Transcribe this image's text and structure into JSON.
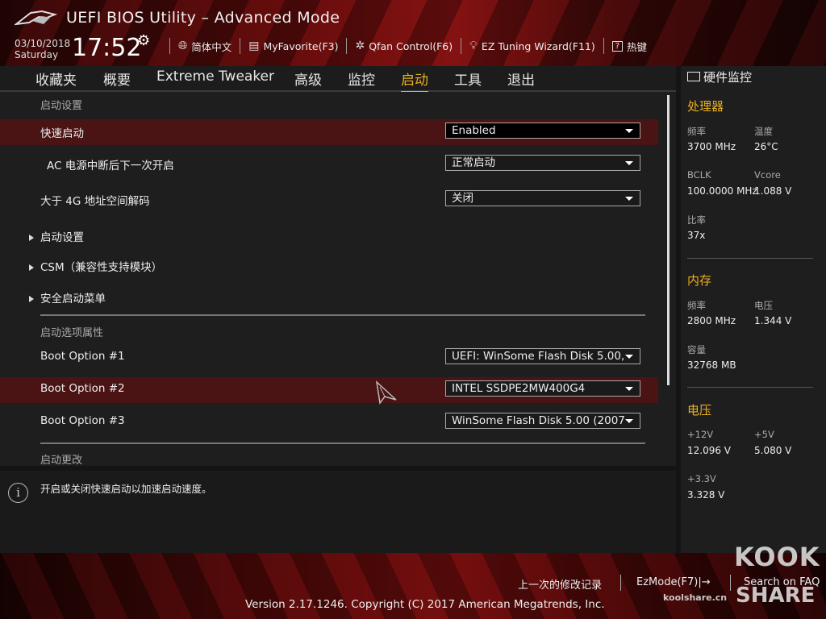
{
  "header": {
    "title": "UEFI BIOS Utility – Advanced Mode",
    "date": "03/10/2018",
    "day": "Saturday",
    "time": "17:52",
    "toolbar": [
      {
        "icon": "globe-icon",
        "label": "简体中文"
      },
      {
        "icon": "favorite-icon",
        "label": "MyFavorite(F3)"
      },
      {
        "icon": "fan-icon",
        "label": "Qfan Control(F6)"
      },
      {
        "icon": "lightbulb-icon",
        "label": "EZ Tuning Wizard(F11)"
      },
      {
        "icon": "help-icon",
        "label": "热键"
      }
    ]
  },
  "nav": {
    "tabs": [
      "收藏夹",
      "概要",
      "Extreme Tweaker",
      "高级",
      "监控",
      "启动",
      "工具",
      "退出"
    ],
    "active": "启动"
  },
  "main": {
    "section1_title": "启动设置",
    "fast_boot": {
      "label": "快速启动",
      "value": "Enabled"
    },
    "ac_power": {
      "label": "AC 电源中断后下一次开启",
      "value": "正常启动"
    },
    "above4g": {
      "label": "大于 4G 地址空间解码",
      "value": "关闭"
    },
    "submenus": [
      "启动设置",
      "CSM（兼容性支持模块）",
      "安全启动菜单"
    ],
    "section2_title": "启动选项属性",
    "boot_options": [
      {
        "label": "Boot Option #1",
        "value": "UEFI: WinSome Flash Disk 5.00,"
      },
      {
        "label": "Boot Option #2",
        "value": "INTEL SSDPE2MW400G4"
      },
      {
        "label": "Boot Option #3",
        "value": "WinSome Flash Disk 5.00  (2007"
      }
    ],
    "section3_title": "启动更改"
  },
  "help": {
    "text": "开启或关闭快速启动以加速启动速度。"
  },
  "sidebar": {
    "title": "硬件监控",
    "cpu": {
      "title": "处理器",
      "freq_label": "频率",
      "freq_value": "3700 MHz",
      "temp_label": "温度",
      "temp_value": "26°C",
      "bclk_label": "BCLK",
      "bclk_value": "100.0000 MHz",
      "vcore_label": "Vcore",
      "vcore_value": "1.088 V",
      "ratio_label": "比率",
      "ratio_value": "37x"
    },
    "memory": {
      "title": "内存",
      "freq_label": "频率",
      "freq_value": "2800 MHz",
      "volt_label": "电压",
      "volt_value": "1.344 V",
      "cap_label": "容量",
      "cap_value": "32768 MB"
    },
    "voltage": {
      "title": "电压",
      "v12_label": "+12V",
      "v12_value": "12.096 V",
      "v5_label": "+5V",
      "v5_value": "5.080 V",
      "v33_label": "+3.3V",
      "v33_value": "3.328 V"
    }
  },
  "footer": {
    "last_changes": "上一次的修改记录",
    "ezmode": "EzMode(F7)|→",
    "search": "Search on FAQ",
    "copyright": "Version 2.17.1246. Copyright (C) 2017 American Megatrends, Inc."
  },
  "watermark": {
    "top": "KOOK",
    "site": "koolshare.cn",
    "bottom": "SHARE"
  },
  "colors": {
    "accent": "#e8b020",
    "highlight_row": "#4a1414",
    "brand_red": "#7a1010"
  }
}
